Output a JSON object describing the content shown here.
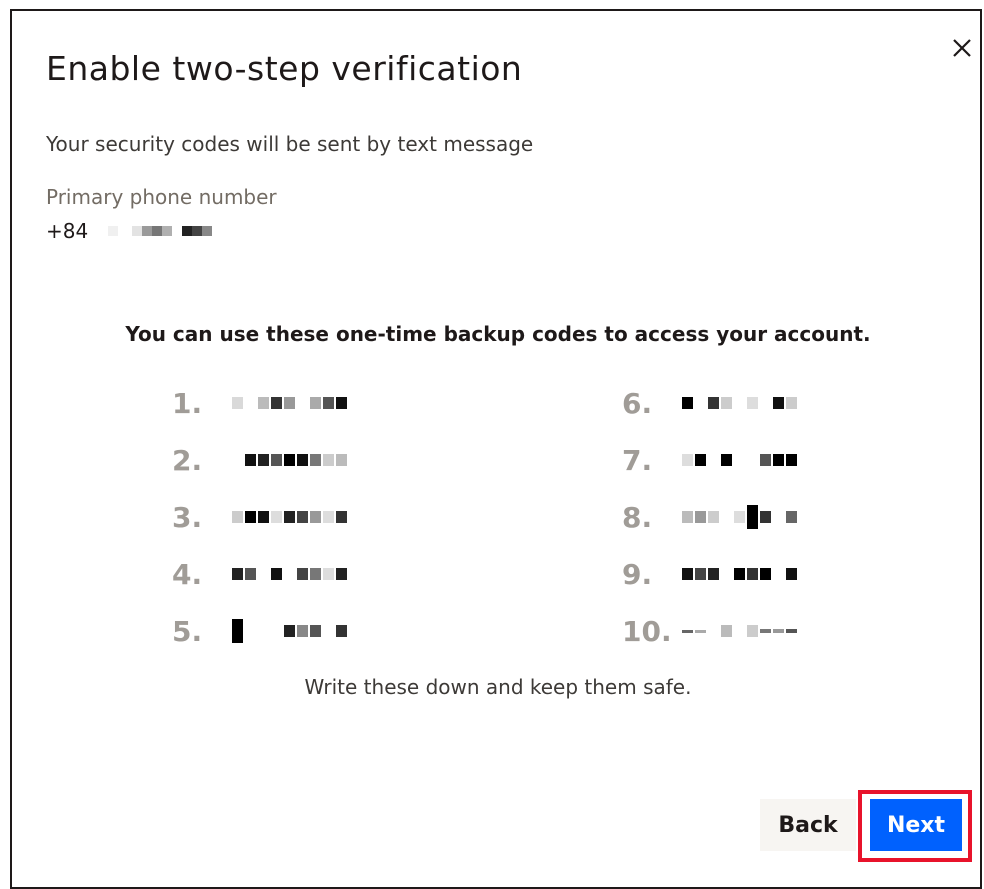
{
  "dialog": {
    "title": "Enable two-step verification",
    "close_icon": "close-icon",
    "subtitle": "Your security codes will be sent by text message",
    "phone_label": "Primary phone number",
    "phone_prefix": "+84",
    "codes_heading": "You can use these one-time backup codes to access your account.",
    "codes": [
      {
        "num": "1."
      },
      {
        "num": "2."
      },
      {
        "num": "3."
      },
      {
        "num": "4."
      },
      {
        "num": "5."
      },
      {
        "num": "6."
      },
      {
        "num": "7."
      },
      {
        "num": "8."
      },
      {
        "num": "9."
      },
      {
        "num": "10."
      }
    ],
    "instruction": "Write these down and keep them safe.",
    "back_label": "Back",
    "next_label": "Next"
  },
  "colors": {
    "primary": "#0061fe",
    "highlight": "#e8132b",
    "text": "#1e1919",
    "muted": "#736c64",
    "code_number": "#a09c97"
  }
}
